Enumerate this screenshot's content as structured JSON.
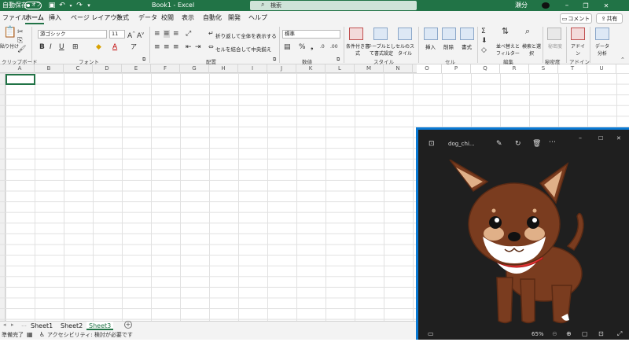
{
  "titlebar": {
    "autosave_label": "自動保存",
    "autosave_state": "オフ",
    "doc_title": "Book1 - Excel",
    "search_placeholder": "検索",
    "user_name": "瀬分",
    "accent": "#217346"
  },
  "tabs": [
    "ファイル",
    "ホーム",
    "挿入",
    "ページ レイアウト",
    "数式",
    "データ",
    "校閲",
    "表示",
    "自動化",
    "開発",
    "ヘルプ"
  ],
  "active_tab": "ホーム",
  "buttons": {
    "comment": "コメント",
    "share": "共有"
  },
  "ribbon": {
    "clipboard": {
      "paste": "貼り付け",
      "group": "クリップボード"
    },
    "font": {
      "name": "游ゴシック",
      "size": "11",
      "group": "フォント"
    },
    "alignment": {
      "wrap": "折り返して全体を表示する",
      "merge": "セルを結合して中央揃え",
      "group": "配置"
    },
    "number": {
      "format": "標準",
      "group": "数値"
    },
    "styles": {
      "conditional": "条件付き書式",
      "table": "テーブルとして書式設定",
      "cell": "セルのスタイル",
      "group": "スタイル"
    },
    "cells": {
      "insert": "挿入",
      "delete": "削除",
      "format": "書式",
      "group": "セル"
    },
    "editing": {
      "sort": "並べ替えとフィルター",
      "find": "検索と選択",
      "group": "編集"
    },
    "sensitivity": {
      "label": "秘密度",
      "group": "秘密度"
    },
    "addins": {
      "label": "アドイン",
      "group": "アドイン"
    },
    "analysis": {
      "label": "データ分析"
    }
  },
  "columns": [
    "A",
    "B",
    "C",
    "D",
    "E",
    "F",
    "G",
    "H",
    "I",
    "J",
    "K",
    "L",
    "M",
    "N",
    "O",
    "P",
    "Q",
    "R",
    "S",
    "T",
    "U"
  ],
  "sheets": [
    "Sheet1",
    "Sheet2",
    "Sheet3"
  ],
  "active_sheet": "Sheet3",
  "status": {
    "ready": "準備完了",
    "accessibility": "アクセシビリティ: 検討が必要です"
  },
  "photo_viewer": {
    "filename": "dog_chi...",
    "zoom": "65%",
    "accent": "#0a7ad4"
  }
}
